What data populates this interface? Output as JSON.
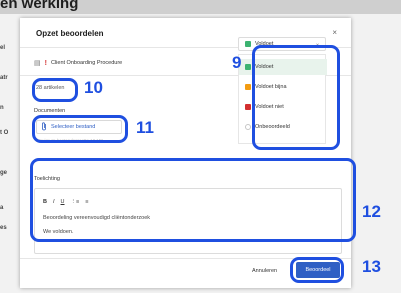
{
  "background": {
    "page_title": "en werking",
    "side_fragments": [
      "el",
      "atr",
      "n",
      "t O",
      "ge",
      "a",
      "es"
    ]
  },
  "modal": {
    "title": "Opzet beoordelen",
    "close_glyph": "×",
    "procedure_name": "Client Onboarding Procedure",
    "articles": "28 artikelen",
    "documents_label": "Documenten",
    "upload_label": "Selecteer bestand",
    "upload_hint": "Maximum bestandsgrootte 10 MB",
    "explanation_label": "Toelichting",
    "editor_lines": [
      "Beoordeling vereenvoudigd cliëntonderzoek",
      "We voldoen."
    ],
    "toolbar": {
      "bold": "B",
      "italic": "I",
      "underline": "U",
      "numbered_list": "⋮≡",
      "bullet_list": "≡"
    },
    "cancel_label": "Annuleren",
    "submit_label": "Beoordeel"
  },
  "status_dropdown": {
    "selected": "Voldoet",
    "options": [
      {
        "label": "Voldoet",
        "color": "#3cb371"
      },
      {
        "label": "Voldoet bijna",
        "color": "#f39c12"
      },
      {
        "label": "Voldoet niet",
        "color": "#d32f2f"
      },
      {
        "label": "Onbeoordeeld",
        "color": "#ffffff"
      }
    ]
  },
  "annotations": {
    "n9": "9",
    "n10": "10",
    "n11": "11",
    "n12": "12",
    "n13": "13"
  },
  "colors": {
    "highlight": "#1f4fe0",
    "primary": "#2f5fc4"
  }
}
